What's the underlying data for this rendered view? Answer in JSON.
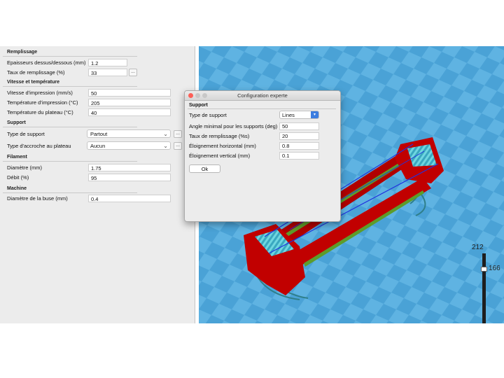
{
  "settings": {
    "remplissage": {
      "title": "Remplissage",
      "epaisseur_label": "Epaisseurs dessus/dessous (mm)",
      "epaisseur_value": "1.2",
      "taux_label": "Taux de remplissage (%)",
      "taux_value": "33",
      "more_label": "..."
    },
    "vitesse": {
      "title": "Vitesse et température",
      "vitesse_label": "Vitesse d'impression (mm/s)",
      "vitesse_value": "50",
      "temp_label": "Température d'impression (°C)",
      "temp_value": "205",
      "plateau_label": "Température du plateau (°C)",
      "plateau_value": "40"
    },
    "support": {
      "title": "Support",
      "type_label": "Type de support",
      "type_value": "Partout",
      "accroche_label": "Type d'accroche au plateau",
      "accroche_value": "Aucun",
      "more_label": "..."
    },
    "filament": {
      "title": "Filament",
      "diametre_label": "Diamètre (mm)",
      "diametre_value": "1.75",
      "debit_label": "Débit (%)",
      "debit_value": "95"
    },
    "machine": {
      "title": "Machine",
      "buse_label": "Diamètre de la buse (mm)",
      "buse_value": "0.4"
    }
  },
  "dialog": {
    "title": "Configuration experte",
    "section": "Support",
    "type_label": "Type de support",
    "type_value": "Lines",
    "angle_label": "Angle minimal pour les supports (deg)",
    "angle_value": "50",
    "taux_label": "Taux de remplissage (%s)",
    "taux_value": "20",
    "horiz_label": "Éloignement horizontal (mm)",
    "horiz_value": "0.8",
    "vert_label": "Éloignement vertical (mm)",
    "vert_value": "0.1",
    "ok_label": "Ok"
  },
  "layer": {
    "max": "212",
    "current": "166",
    "fraction": 0.78
  },
  "colors": {
    "checker_a": "#5fb3e2",
    "checker_b": "#4aa2d6",
    "model": "#c10000",
    "support": "#5d9c2a",
    "infill": "#6fd6e0"
  },
  "icons": {
    "chevron": "chevron-down-icon",
    "close": "close-icon",
    "minimize": "minimize-icon",
    "zoom": "zoom-icon"
  }
}
